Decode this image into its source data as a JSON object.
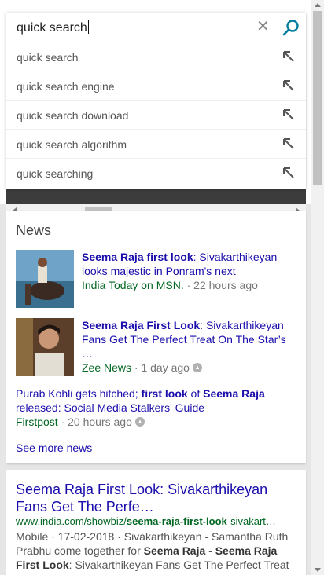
{
  "search": {
    "query": "quick search",
    "clear_icon": "close-icon",
    "suggestions": [
      {
        "label": "quick search"
      },
      {
        "label": "quick search engine"
      },
      {
        "label": "quick search download"
      },
      {
        "label": "quick search algorithm"
      },
      {
        "label": "quick searching"
      }
    ]
  },
  "news": {
    "title": "News",
    "items": [
      {
        "headline_bold": "Seema Raja first look",
        "headline_rest": ": Sivakarthikeyan looks majestic in Ponram's next",
        "source": "India Today on MSN.",
        "time": " · 22 hours ago"
      },
      {
        "headline_bold": "Seema Raja First Look",
        "headline_rest": ": Sivakarthikeyan Fans Get The Perfect Treat On The Star’s …",
        "source": "Zee News",
        "time": " · 1 day ago"
      },
      {
        "headline_pre": "Purab Kohli gets hitched; ",
        "headline_bold1": "first look",
        "headline_mid": " of ",
        "headline_bold2": "Seema Raja",
        "headline_rest": " released: Social Media Stalkers' Guide",
        "source": "Firstpost",
        "time": " · 20 hours ago"
      }
    ],
    "see_more": "See more news"
  },
  "result": {
    "title": "Seema Raja First Look: Sivakarthikeyan Fans Get The Perfe…",
    "url_pre": "www.india.com/showbiz/",
    "url_bold": "seema-raja-first-look",
    "url_post": "-sivakart…",
    "snippet_pre": "Mobile · 17-02-2018 · Sivakarthikeyan - Samantha Ruth Prabhu come together for ",
    "snippet_b1": "Seema Raja",
    "snippet_mid": " - ",
    "snippet_b2": "Seema Raja First Look",
    "snippet_post": ": Sivakarthikeyan Fans Get The Perfect Treat"
  },
  "colors": {
    "link": "#1a0dab",
    "source_green": "#006621",
    "accent_teal": "#007c9e"
  }
}
